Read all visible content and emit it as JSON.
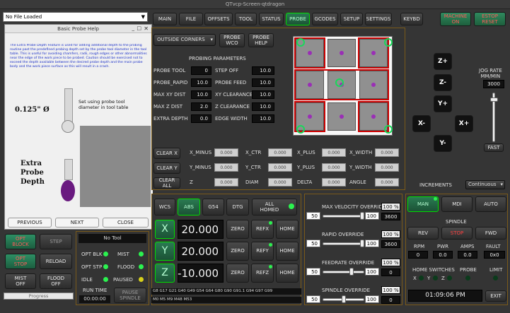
{
  "window": {
    "title": "QTvcp-Screen-qtdragon"
  },
  "file": {
    "label": "No File Loaded"
  },
  "tabs": [
    "MAIN",
    "FILE",
    "OFFSETS",
    "TOOL",
    "STATUS",
    "PROBE",
    "GCODES",
    "SETUP",
    "SETTINGS",
    "KEYBD"
  ],
  "machine_on": "MACHINE\nON",
  "estop_reset": "ESTOP\nRESET",
  "help": {
    "title": "Basic Probe Help",
    "text": "The Extra Probe Depth Feature is used for adding additional depth to the probing routine past the predefined probing depth set by the probe tool diameter in the tool table. This is useful for avoiding chamfers, radii, rough edges or other abnormalities near the edge of the work piece to be probed. Caution should be exercised not to exceed the depth available between the desired probe depth and the main probe body and the work piece surface as this will result in a crash.",
    "diameter": "0.125\" Ø",
    "set_using": "Set using probe tool\ndiameter in tool table",
    "extra": "Extra\nProbe\nDepth",
    "previous": "PREVIOUS",
    "next": "NEXT",
    "close": "CLOSE"
  },
  "probe": {
    "mode": "OUTSIDE CORNERS",
    "wco": "PROBE\nWCO",
    "help": "PROBE\nHELP",
    "params_title": "PROBING PARAMETERS",
    "left": [
      {
        "label": "PROBE TOOL",
        "value": "0"
      },
      {
        "label": "PROBE_RAPID",
        "value": "10.0"
      },
      {
        "label": "MAX XY DIST",
        "value": "10.0"
      },
      {
        "label": "MAX Z DIST",
        "value": "2.0"
      },
      {
        "label": "EXTRA DEPTH",
        "value": "0.0"
      }
    ],
    "right": [
      {
        "label": "STEP OFF",
        "value": "10.0"
      },
      {
        "label": "PROBE FEED",
        "value": "10.0"
      },
      {
        "label": "XY CLEARANCE",
        "value": "10.0"
      },
      {
        "label": "Z CLEARANCE",
        "value": "10.0"
      },
      {
        "label": "EDGE WIDTH",
        "value": "10.0"
      }
    ],
    "clear_x": "CLEAR X",
    "clear_y": "CLEAR Y",
    "clear_all": "CLEAR ALL",
    "results": [
      [
        "X_MINUS",
        "X_CTR",
        "X_PLUS",
        "X_WIDTH"
      ],
      [
        "Y_MINUS",
        "Y_CTR",
        "Y_PLUS",
        "Y_WIDTH"
      ],
      [
        "Z",
        "DIAM",
        "DELTA",
        "ANGLE"
      ]
    ],
    "result_value": "0.000"
  },
  "jog": {
    "rate_label": "JOG RATE\nMM/MIN",
    "rate": "3000",
    "fast": "FAST",
    "increments_label": "INCREMENTS",
    "increments": "Continuous"
  },
  "dro": {
    "wcs": "WCS",
    "abs": "ABS",
    "g54": "G54",
    "dtg": "DTG",
    "homed": "ALL\nHOMED",
    "axes": [
      {
        "name": "X",
        "value": "20.000",
        "ref": "REFX"
      },
      {
        "name": "Y",
        "value": "20.000",
        "ref": "REFY"
      },
      {
        "name": "Z",
        "value": "-10.000",
        "ref": "REFZ"
      }
    ],
    "zero": "ZERO",
    "home": "HOME",
    "gcodes": "G8 G17 G21 G40 G49 G54 G64 G80 G90 G91.1 G94 G97 G99",
    "mcodes": "M0 M5 M9 M48 M53"
  },
  "overrides": [
    {
      "label": "MAX VELOCITY OVERRIDE",
      "pct": "100 %",
      "min": "50",
      "max": "100",
      "value": "3600",
      "fill": 1.0
    },
    {
      "label": "RAPID OVERRIDE",
      "pct": "100 %",
      "min": "50",
      "max": "100",
      "value": "3600",
      "fill": 1.0
    },
    {
      "label": "FEEDRATE OVERRIDE",
      "pct": "100 %",
      "min": "50",
      "max": "100",
      "value": "0",
      "fill": 0.71
    },
    {
      "label": "SPINDLE OVERRIDE",
      "pct": "100 %",
      "min": "50",
      "max": "100",
      "value": "0",
      "fill": 0.5
    }
  ],
  "mode": {
    "man": "MAN",
    "mdi": "MDI",
    "auto": "AUTO"
  },
  "spindle": {
    "title": "SPINDLE",
    "rev": "REV",
    "stop": "STOP",
    "fwd": "FWD",
    "rpm": "RPM",
    "pwr": "PWR",
    "amps": "AMPS",
    "fault": "FAULT",
    "rpm_v": "0",
    "pwr_v": "0.0",
    "amps_v": "0.0",
    "fault_v": "0x0",
    "home_switches": "HOME SWITCHES",
    "probe": "PROBE",
    "limit": "LIMIT",
    "x": "X",
    "y": "Y",
    "z": "Z",
    "time": "01:09:06 PM",
    "exit": "EXIT"
  },
  "status": {
    "opt_block": "OPT\nBLOCK",
    "step": "STEP",
    "opt_stop": "OPT\nSTOP",
    "reload": "RELOAD",
    "mist": "MIST\nOFF",
    "flood": "FLOOD\nOFF",
    "progress": "Progress",
    "tool": "No Tool",
    "opt_blk": "OPT BLK",
    "opt_stp": "OPT STP",
    "idle": "IDLE",
    "mist_l": "MIST",
    "flood_l": "FLOOD",
    "paused": "PAUSED",
    "run_time": "RUN TIME",
    "run_time_v": "00:00:00",
    "pause_spindle": "PAUSE\nSPINDLE"
  }
}
